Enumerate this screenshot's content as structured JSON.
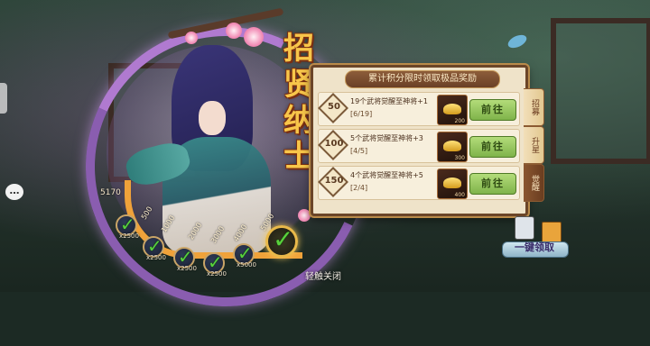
{
  "title": {
    "chars": [
      "招",
      "贤",
      "纳",
      "士"
    ]
  },
  "panel": {
    "header": "累计积分限时领取极品奖励",
    "rows": [
      {
        "points": "50",
        "desc": "19个武将觉醒至神将+1",
        "progress": "[6/19]",
        "item_count": "200",
        "button": "前往"
      },
      {
        "points": "100",
        "desc": "5个武将觉醒至神将+3",
        "progress": "[4/5]",
        "item_count": "300",
        "button": "前往"
      },
      {
        "points": "150",
        "desc": "4个武将觉醒至神将+5",
        "progress": "[2/4]",
        "item_count": "400",
        "button": "前往"
      }
    ]
  },
  "tabs": [
    "招募",
    "升星",
    "觉醒"
  ],
  "active_tab": "觉醒",
  "progress_track": {
    "current_score": "5170",
    "ticks": [
      "500",
      "1000",
      "2000",
      "3000",
      "4000",
      "5000"
    ],
    "rewards": [
      {
        "label": "x2500",
        "claimed": true
      },
      {
        "label": "x2500",
        "claimed": true
      },
      {
        "label": "x2500",
        "claimed": true
      },
      {
        "label": "x2500",
        "claimed": true
      },
      {
        "label": "x5000",
        "claimed": true
      },
      {
        "label": "",
        "claimed": true
      }
    ]
  },
  "close_hint": "轻触关闭",
  "emblem_label": "一键领取",
  "icons": {
    "check": "check-icon",
    "item": "golden-shoe-icon",
    "chat": "chat-bubble-icon"
  }
}
